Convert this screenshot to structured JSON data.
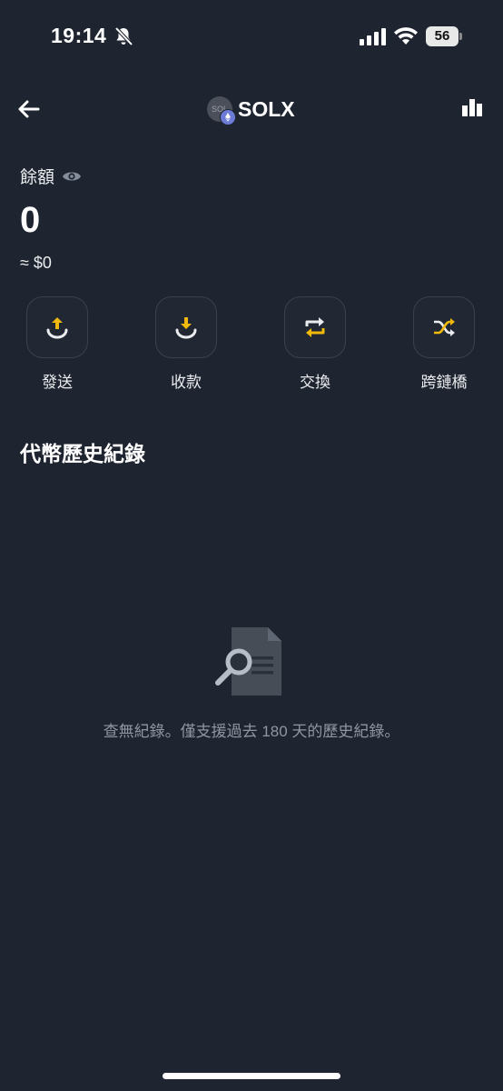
{
  "status_bar": {
    "time": "19:14",
    "battery": "56"
  },
  "header": {
    "token_symbol": "SOLX",
    "token_logo_text": "SOL"
  },
  "balance": {
    "label": "餘額",
    "amount": "0",
    "fiat": "≈ $0"
  },
  "actions": [
    {
      "label": "發送",
      "icon": "send-icon"
    },
    {
      "label": "收款",
      "icon": "receive-icon"
    },
    {
      "label": "交換",
      "icon": "swap-icon"
    },
    {
      "label": "跨鏈橋",
      "icon": "bridge-icon"
    }
  ],
  "history": {
    "title": "代幣歷史紀錄",
    "empty_message": "查無紀錄。僅支援過去 180 天的歷史紀錄。"
  },
  "colors": {
    "background": "#1f2530",
    "accent": "#f0b90b",
    "muted_text": "#8f96a3"
  }
}
